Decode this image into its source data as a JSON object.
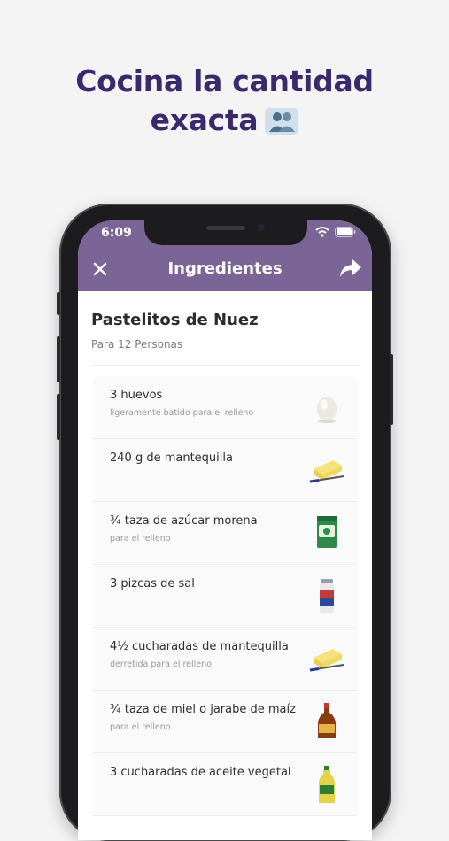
{
  "promo": {
    "headline_line1": "Cocina la cantidad",
    "headline_line2": "exacta",
    "headline_icon": "people-icon"
  },
  "colors": {
    "headline": "#3b2a6b",
    "header_bg": "#7b6597"
  },
  "status_bar": {
    "time": "6:09",
    "icons": [
      "wifi-icon",
      "battery-icon"
    ]
  },
  "header": {
    "title": "Ingredientes",
    "left_icon": "close-icon",
    "right_icon": "share-icon"
  },
  "recipe": {
    "title": "Pastelitos de Nuez",
    "servings": "Para 12 Personas"
  },
  "ingredients": [
    {
      "name": "3 huevos",
      "note": "ligeramente batido para el relleno",
      "icon": "egg-icon"
    },
    {
      "name": "240 g de mantequilla",
      "note": "",
      "icon": "butter-icon"
    },
    {
      "name": "¾ taza de azúcar morena",
      "note": "para el relleno",
      "icon": "sugar-bag-icon"
    },
    {
      "name": "3 pizcas de sal",
      "note": "",
      "icon": "salt-shaker-icon"
    },
    {
      "name": "4½ cucharadas de mantequilla",
      "note": "derretida para el relleno",
      "icon": "butter-icon"
    },
    {
      "name": "¾ taza de miel o jarabe de maíz",
      "note": "para el relleno",
      "icon": "syrup-bottle-icon"
    },
    {
      "name": "3 cucharadas de aceite vegetal",
      "note": "",
      "icon": "oil-bottle-icon"
    }
  ]
}
